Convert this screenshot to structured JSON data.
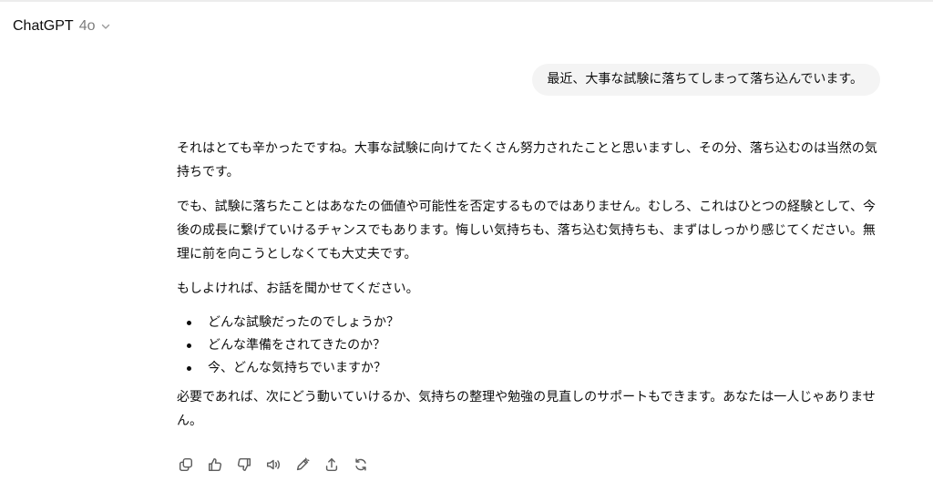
{
  "header": {
    "brand": "ChatGPT",
    "model": "4o"
  },
  "user_message": "最近、大事な試験に落ちてしまって落ち込んでいます。",
  "assistant": {
    "paragraphs": [
      "それはとても辛かったですね。大事な試験に向けてたくさん努力されたことと思いますし、その分、落ち込むのは当然の気持ちです。",
      "でも、試験に落ちたことはあなたの価値や可能性を否定するものではありません。むしろ、これはひとつの経験として、今後の成長に繋げていけるチャンスでもあります。悔しい気持ちも、落ち込む気持ちも、まずはしっかり感じてください。無理に前を向こうとしなくても大丈夫です。",
      "もしよければ、お話を聞かせてください。"
    ],
    "bullets": [
      "どんな試験だったのでしょうか？",
      "どんな準備をされてきたのか？",
      "今、どんな気持ちでいますか？"
    ],
    "closing": "必要であれば、次にどう動いていけるか、気持ちの整理や勉強の見直しのサポートもできます。あなたは一人じゃありません。"
  },
  "actions": [
    "copy-icon",
    "thumbs-up-icon",
    "thumbs-down-icon",
    "read-aloud-icon",
    "edit-icon",
    "share-icon",
    "regenerate-icon"
  ],
  "colors": {
    "bubble_bg": "#f4f4f4",
    "text": "#0d0d0d",
    "muted": "#7d7d7d",
    "icon": "#5d5d5d"
  }
}
